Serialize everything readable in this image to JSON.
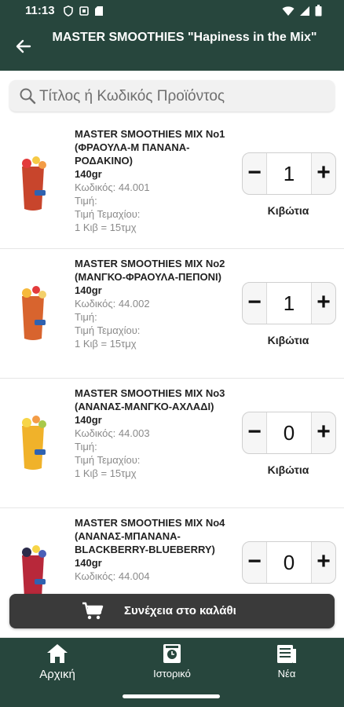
{
  "status": {
    "time": "11:13"
  },
  "header": {
    "title": "MASTER SMOOTHIES \"Hapiness in the Mix\""
  },
  "search": {
    "placeholder": "Τίτλος ή Κωδικός Προϊόντος"
  },
  "products": [
    {
      "name": "MASTER SMOOTHIES MIX No1 (ΦΡΑΟΥΛΑ-Μ ΠΑΝΑΝΑ-ΡΟΔΑΚΙΝΟ)",
      "weight": "140gr",
      "code": "Κωδικός: 44.001",
      "price": "Τιμή:",
      "unit_price": "Τιμή Τεμαχίου:",
      "pack": "1 Κιβ = 15τμχ",
      "qty": "1",
      "unit": "Κιβώτια",
      "color": "#c8452c"
    },
    {
      "name": "MASTER SMOOTHIES MIX No2 (ΜΑΝΓΚΟ-ΦΡΑΟΥΛΑ-ΠΕΠΟΝΙ)",
      "weight": "140gr",
      "code": "Κωδικός: 44.002",
      "price": "Τιμή:",
      "unit_price": "Τιμή Τεμαχίου:",
      "pack": "1 Κιβ = 15τμχ",
      "qty": "1",
      "unit": "Κιβώτια",
      "color": "#d8642e"
    },
    {
      "name": "MASTER SMOOTHIES MIX No3 (ΑΝΑΝΑΣ-ΜΑΝΓΚΟ-ΑΧΛΑΔΙ)",
      "weight": "140gr",
      "code": "Κωδικός: 44.003",
      "price": "Τιμή:",
      "unit_price": "Τιμή Τεμαχίου:",
      "pack": "1 Κιβ = 15τμχ",
      "qty": "0",
      "unit": "Κιβώτια",
      "color": "#f0b22a"
    },
    {
      "name": "MASTER SMOOTHIES MIX No4 (ΑΝΑΝΑΣ-ΜΠΑΝΑΝΑ-BLACKBERRY-BLUEBERRY)",
      "weight": "140gr",
      "code": "Κωδικός: 44.004",
      "qty": "0",
      "color": "#b8283a"
    }
  ],
  "cart": {
    "label": "Συνέχεια στο καλάθι"
  },
  "nav": {
    "home": "Αρχική",
    "history": "Ιστορικό",
    "news": "Νέα"
  }
}
